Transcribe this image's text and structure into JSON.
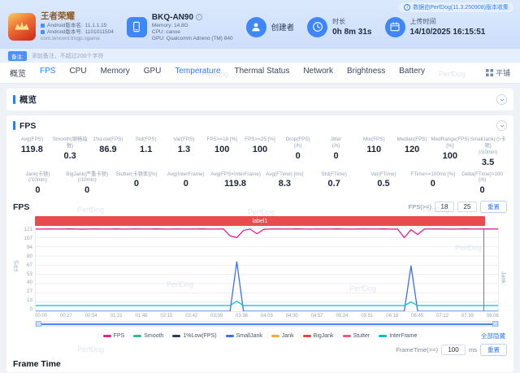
{
  "watermark": "PerfDog",
  "header": {
    "game": {
      "name": "王者荣耀",
      "lines": [
        {
          "label": "Android版本名:",
          "value": "11.1.1.15"
        },
        {
          "label": "Android版本号:",
          "value": "1101011504"
        }
      ],
      "package": "com.tencent.tmgp.sgame"
    },
    "device": {
      "model": "BKQ-AN90",
      "specs": [
        "Memory: 14.8G",
        "CPU: canoe",
        "GPU: Qualcomm Adreno (TM) 840"
      ]
    },
    "creator": {
      "label": "创建者"
    },
    "duration": {
      "label": "时长",
      "value": "0h 8m 31s"
    },
    "upload": {
      "label": "上传时间",
      "value": "14/10/2025 16:15:51"
    },
    "collect_note": "数据由PerfDog(11.3.250908)版本收集"
  },
  "note": {
    "badge": "备注:",
    "placeholder": "添加备注，不超过200个字符"
  },
  "nav": {
    "tabs": [
      {
        "label": "概览",
        "active": false
      },
      {
        "label": "FPS",
        "active": true
      },
      {
        "label": "CPU",
        "active": false
      },
      {
        "label": "Memory",
        "active": false
      },
      {
        "label": "GPU",
        "active": false
      },
      {
        "label": "Temperature",
        "active": false,
        "highlight": true
      },
      {
        "label": "Thermal Status",
        "active": false
      },
      {
        "label": "Network",
        "active": false
      },
      {
        "label": "Brightness",
        "active": false
      },
      {
        "label": "Battery",
        "active": false
      }
    ],
    "tile_label": "平铺"
  },
  "overview": {
    "title": "概览"
  },
  "fps_panel": {
    "title": "FPS",
    "stats": [
      [
        {
          "label": "Avg(FPS)",
          "value": "119.8"
        },
        {
          "label": "Smooth(顺畅指数)",
          "value": "0.3"
        },
        {
          "label": "1%Low(FPS)",
          "value": "86.9"
        },
        {
          "label": "Std(FPS)",
          "value": "1.1"
        },
        {
          "label": "Var(FPS)",
          "value": "1.3"
        },
        {
          "label": "FPS>=18 [%]",
          "value": "100"
        },
        {
          "label": "FPS>=25 [%]",
          "value": "100"
        },
        {
          "label": "Drop(FPS)",
          "sub": "(/h)",
          "value": "0"
        },
        {
          "label": "Jitter",
          "sub": "(/h)",
          "value": "0"
        },
        {
          "label": "Min(FPS)",
          "value": "110"
        },
        {
          "label": "Median(FPS)",
          "value": "120"
        },
        {
          "label": "MedRange(FPS)[%]",
          "value": "100"
        },
        {
          "label": "SmallJank(小卡顿)",
          "sub": "(/10min)",
          "value": "3.5"
        }
      ],
      [
        {
          "label": "Jank(卡顿)",
          "sub": "(/10min)",
          "value": "0"
        },
        {
          "label": "BigJank(严重卡顿)",
          "sub": "(/10min)",
          "value": "0"
        },
        {
          "label": "Stutter(卡顿率)[%]",
          "value": "0"
        },
        {
          "label": "Avg(InterFrame)",
          "value": "0"
        },
        {
          "label": "Avg(FPS×InterFrame)",
          "value": "119.8"
        },
        {
          "label": "Avg(FTime) [ms]",
          "value": "8.3"
        },
        {
          "label": "Std(FTime)",
          "value": "0.7"
        },
        {
          "label": "Var(FTime)",
          "value": "0.5"
        },
        {
          "label": "FTime>=100ms [%]",
          "value": "0"
        },
        {
          "label": "Delta(FTime)>100 (/h)",
          "value": "0"
        }
      ]
    ]
  },
  "fps_chart": {
    "title": "FPS",
    "threshold_label": "FPS(>=)",
    "thresholds": [
      "18",
      "25"
    ],
    "reset_label": "重置",
    "hide_all": "全部隐藏",
    "legend": [
      {
        "name": "FPS",
        "color": "#ec1d8e"
      },
      {
        "name": "Smooth",
        "color": "#2bbf8e"
      },
      {
        "name": "1%Low(FPS)",
        "color": "#2b3a55"
      },
      {
        "name": "SmallJank",
        "color": "#3d6ef2"
      },
      {
        "name": "Jank",
        "color": "#f6a936"
      },
      {
        "name": "BigJank",
        "color": "#ee4433"
      },
      {
        "name": "Stutter",
        "color": "#f05a7e"
      },
      {
        "name": "InterFrame",
        "color": "#00c0c8"
      }
    ]
  },
  "frame_time": {
    "title": "Frame Time",
    "threshold_label": "FrameTime(>=)",
    "value": "100",
    "unit": "ms",
    "reset_label": "重置"
  },
  "chart_data": {
    "type": "line",
    "title": "FPS",
    "x_axis": {
      "unit": "time",
      "tick_labels": [
        "00:00",
        "00:27",
        "00:54",
        "01:21",
        "01:48",
        "02:15",
        "02:42",
        "03:09",
        "03:36",
        "04:03",
        "04:30",
        "04:57",
        "05:24",
        "05:51",
        "06:18",
        "06:45",
        "07:12",
        "07:39",
        "08:06"
      ]
    },
    "y_left": {
      "label": "FPS",
      "min": 0,
      "max": 121,
      "tick_labels": [
        121,
        107,
        94,
        80,
        67,
        53,
        40,
        27,
        13,
        0
      ]
    },
    "y_right": {
      "label": "Jank",
      "min": 0,
      "max": 2
    },
    "grid": true,
    "legend_position": "bottom",
    "annotation": {
      "label": "label1",
      "span": [
        0,
        0.97
      ]
    },
    "series": [
      {
        "name": "SmallJank",
        "axis": "right",
        "color": "#3d6ef2",
        "values": [
          0,
          0,
          0,
          0,
          0,
          0,
          0,
          0,
          0,
          0,
          0,
          0,
          0,
          0,
          0,
          0,
          0,
          0,
          0,
          0,
          0,
          0,
          0,
          0,
          0,
          0,
          0,
          0,
          0,
          0,
          1.2,
          0,
          0,
          0,
          0,
          0,
          0,
          0,
          0,
          0,
          0,
          0,
          0,
          0,
          0,
          0,
          0,
          0,
          0,
          0,
          0,
          0,
          0,
          0,
          0,
          0,
          1.1,
          0,
          0,
          0,
          0,
          0,
          0,
          0,
          0,
          0,
          0,
          0,
          0,
          0
        ]
      },
      {
        "name": "InterFrame",
        "axis": "left",
        "color": "#00c0c8",
        "values": [
          8.3,
          8.3,
          8.3,
          8.3,
          8.3,
          8.3,
          8.3,
          8.3,
          8.3,
          8.3,
          8.3,
          8.3,
          8.3,
          8.3,
          8.3,
          8.3,
          8.3,
          8.3,
          8.3,
          8.3,
          8.3,
          8.3,
          8.3,
          8.3,
          8.3,
          8.3,
          8.3,
          8.3,
          8.3,
          8.3,
          14.5,
          8.3,
          8.3,
          8.3,
          8.3,
          8.3,
          8.3,
          8.3,
          8.3,
          8.3,
          8.3,
          8.3,
          8.3,
          8.3,
          8.3,
          8.3,
          8.3,
          8.3,
          8.3,
          8.3,
          8.3,
          8.3,
          8.3,
          8.3,
          8.3,
          8.3,
          13.5,
          8.3,
          8.3,
          8.3,
          8.3,
          8.3,
          8.3,
          8.3,
          8.3,
          8.3,
          8.3,
          8.3,
          8.3,
          8.3
        ]
      },
      {
        "name": "FPS",
        "axis": "left",
        "color": "#ec1d8e",
        "values": [
          120,
          119.8,
          120.1,
          120,
          119.9,
          120.2,
          120,
          119.7,
          120,
          120.1,
          119.9,
          120,
          120.2,
          119.8,
          120,
          120.1,
          119.9,
          120,
          120.2,
          120,
          119.8,
          120.1,
          120,
          119.9,
          120,
          120.2,
          119.8,
          120,
          120.1,
          110,
          107.5,
          118,
          120,
          113,
          119.5,
          120,
          120.1,
          119.9,
          120,
          120.2,
          120,
          119.8,
          120.1,
          120,
          119.9,
          120.2,
          120,
          119.8,
          120,
          120.1,
          119.9,
          120,
          120.2,
          119.8,
          120,
          107.5,
          119,
          112,
          120,
          119.9,
          120.1,
          120,
          119.8,
          120,
          120.2,
          119.9,
          120,
          120.1,
          119.9,
          120
        ]
      }
    ]
  }
}
